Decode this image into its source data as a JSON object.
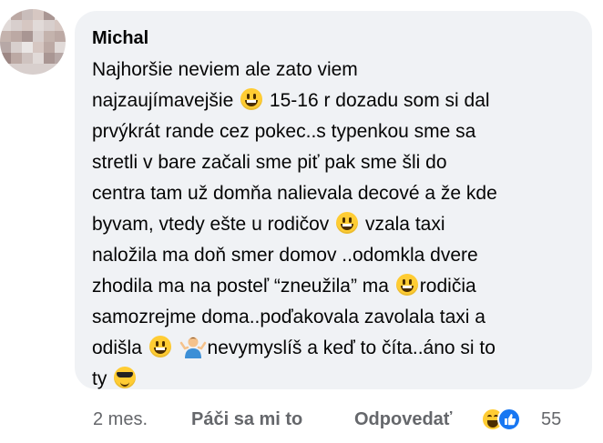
{
  "comment": {
    "author": "Michal",
    "lines": [
      [
        "Najhoršie neviem ale zato viem"
      ],
      [
        "najzaujímavejšie ",
        "{grin}",
        " 15-16 r dozadu som si dal"
      ],
      [
        "prvýkrát rande cez pokec..s typenkou sme sa"
      ],
      [
        "stretli v bare začali sme piť pak sme šli do"
      ],
      [
        "centra tam už domňa nalievala decové a že kde"
      ],
      [
        "byvam, vtedy ešte u rodičov ",
        "{grin}",
        " vzala taxi"
      ],
      [
        "naložila ma doň smer domov ..odomkla dvere"
      ],
      [
        "zhodila ma na posteľ “zneužila” ma ",
        "{grin}",
        "rodičia"
      ],
      [
        "samozrejme doma..poďakovala zavolala taxi a"
      ],
      [
        "odišla ",
        "{grin}",
        " ",
        "{person}",
        "nevymyslíš a keď to číta..áno si to"
      ],
      [
        "ty ",
        "{cool}"
      ]
    ]
  },
  "footer": {
    "time": "2 mes.",
    "like_label": "Páči sa mi to",
    "reply_label": "Odpovedať",
    "reaction_count": "55",
    "reactions": [
      "laugh",
      "like"
    ]
  },
  "icons": {
    "grin": "grinning-face-emoji",
    "person": "person-shrugging-emoji",
    "cool": "sunglasses-face-emoji"
  },
  "colors": {
    "bubble": "#f0f2f5",
    "text": "#050505",
    "meta": "#65676b",
    "like_blue": "#1877f2",
    "emoji_yellow": "#ffcc33"
  }
}
